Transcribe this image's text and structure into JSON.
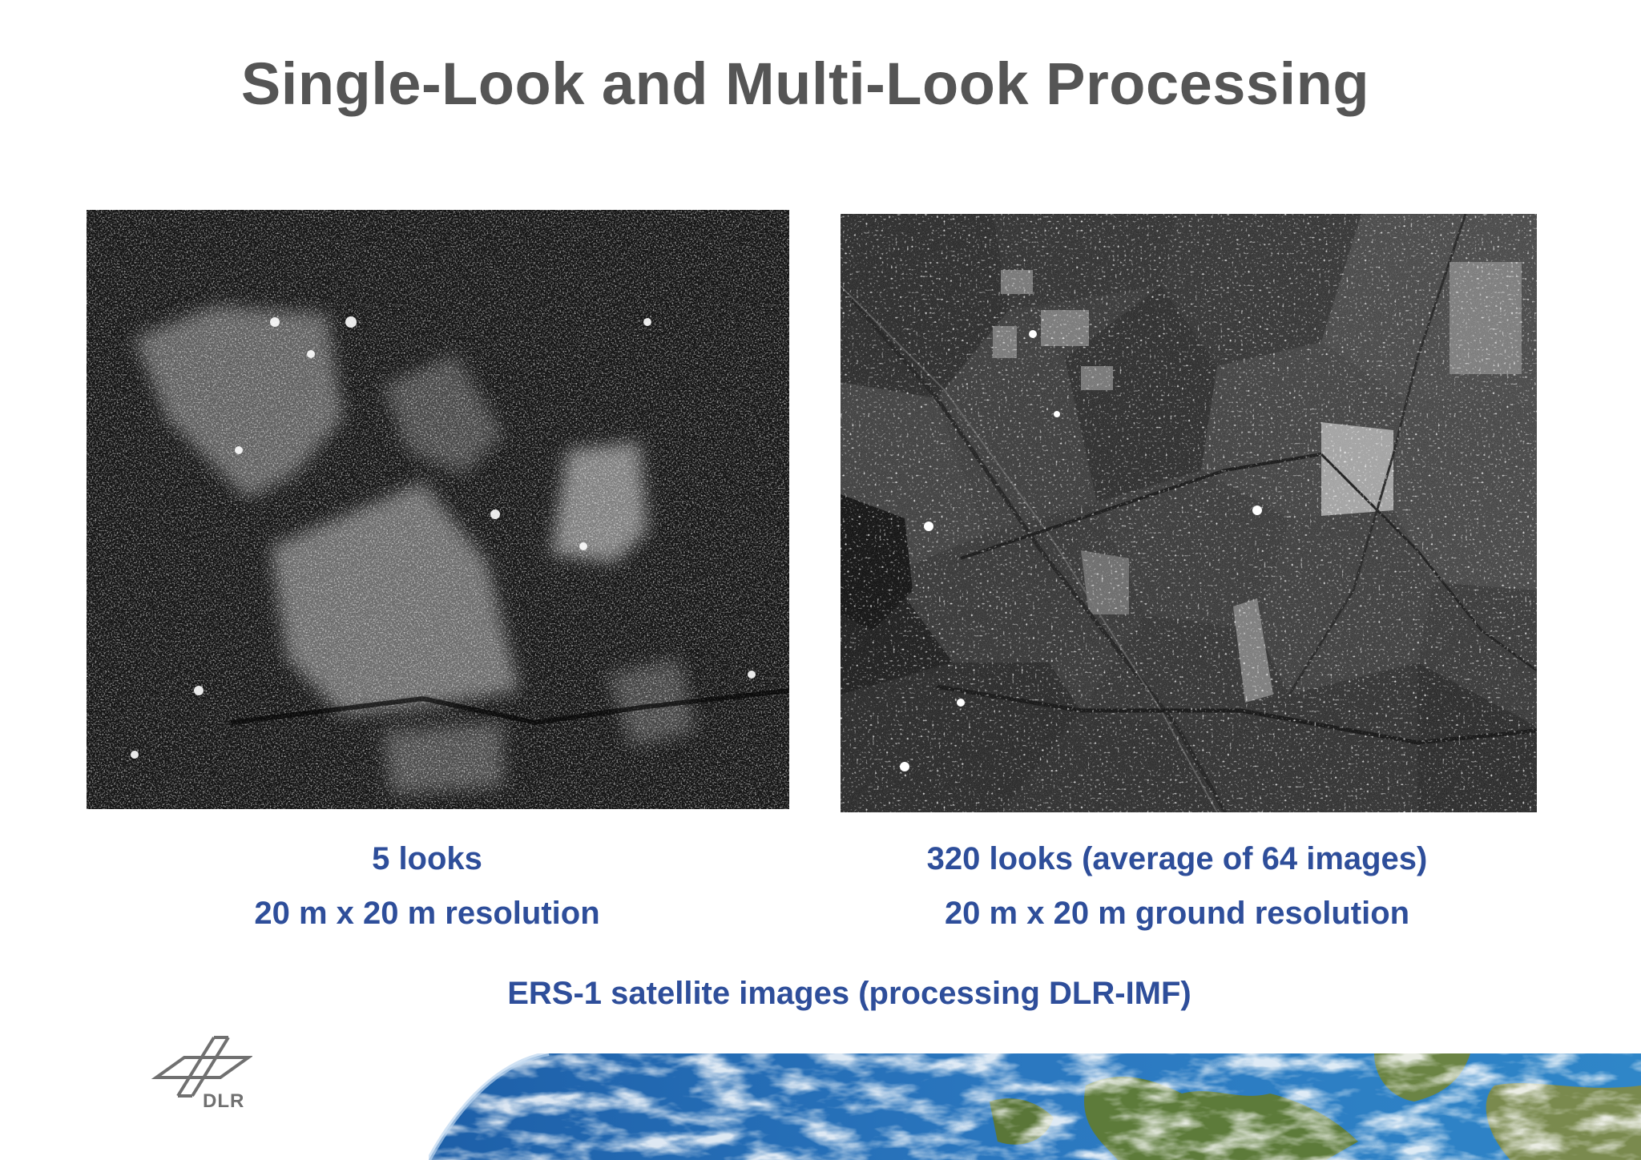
{
  "title": "Single-Look and Multi-Look Processing",
  "left_image": {
    "icon": "sar-single-look-image",
    "caption_line1": "5 looks",
    "caption_line2": "20 m x 20 m resolution"
  },
  "right_image": {
    "icon": "sar-multi-look-image",
    "caption_line1": "320 looks (average of 64 images)",
    "caption_line2": "20 m x 20 m ground resolution"
  },
  "footer_caption": "ERS-1 satellite images (processing DLR-IMF)",
  "logo": {
    "icon": "dlr-logo",
    "text": "DLR"
  },
  "banner": {
    "icon": "earth-banner-image"
  },
  "colors": {
    "title": "#555555",
    "caption": "#2e4e9a",
    "logo": "#707070"
  }
}
